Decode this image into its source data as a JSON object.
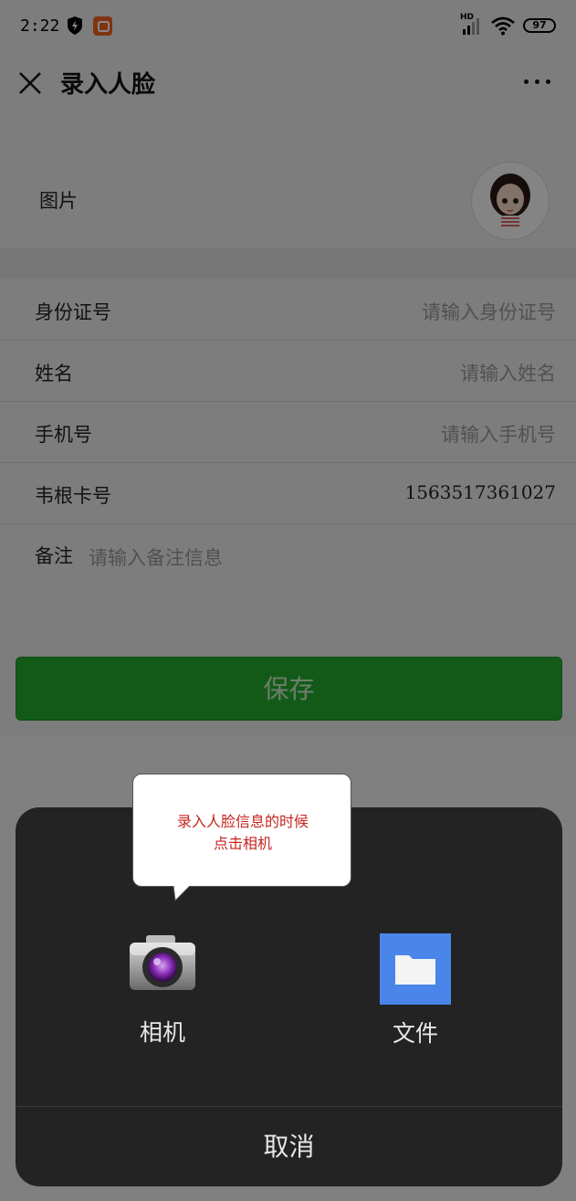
{
  "status_bar": {
    "time": "2:22",
    "signal_label": "HD",
    "battery": "97"
  },
  "nav": {
    "title": "录入人脸",
    "close_icon": "close-icon",
    "more_icon": "more-icon"
  },
  "photo_row": {
    "label": "图片",
    "avatar": "avatar-image"
  },
  "form": {
    "rows": [
      {
        "label": "身份证号",
        "placeholder": "请输入身份证号",
        "value": ""
      },
      {
        "label": "姓名",
        "placeholder": "请输入姓名",
        "value": ""
      },
      {
        "label": "手机号",
        "placeholder": "请输入手机号",
        "value": ""
      },
      {
        "label": "韦根卡号",
        "placeholder": "",
        "value": "1563517361027"
      }
    ],
    "remark": {
      "label": "备注",
      "placeholder": "请输入备注信息"
    },
    "save_label": "保存"
  },
  "action_sheet": {
    "options": [
      {
        "label": "相机",
        "icon": "camera-icon"
      },
      {
        "label": "文件",
        "icon": "folder-icon"
      }
    ],
    "cancel_label": "取消"
  },
  "tooltip": {
    "line1": "录入人脸信息的时候",
    "line2": "点击相机"
  },
  "colors": {
    "primary_green": "#25aa30",
    "sheet_bg": "#232323",
    "tooltip_text": "#c8241d",
    "file_blue": "#4a86ea"
  }
}
